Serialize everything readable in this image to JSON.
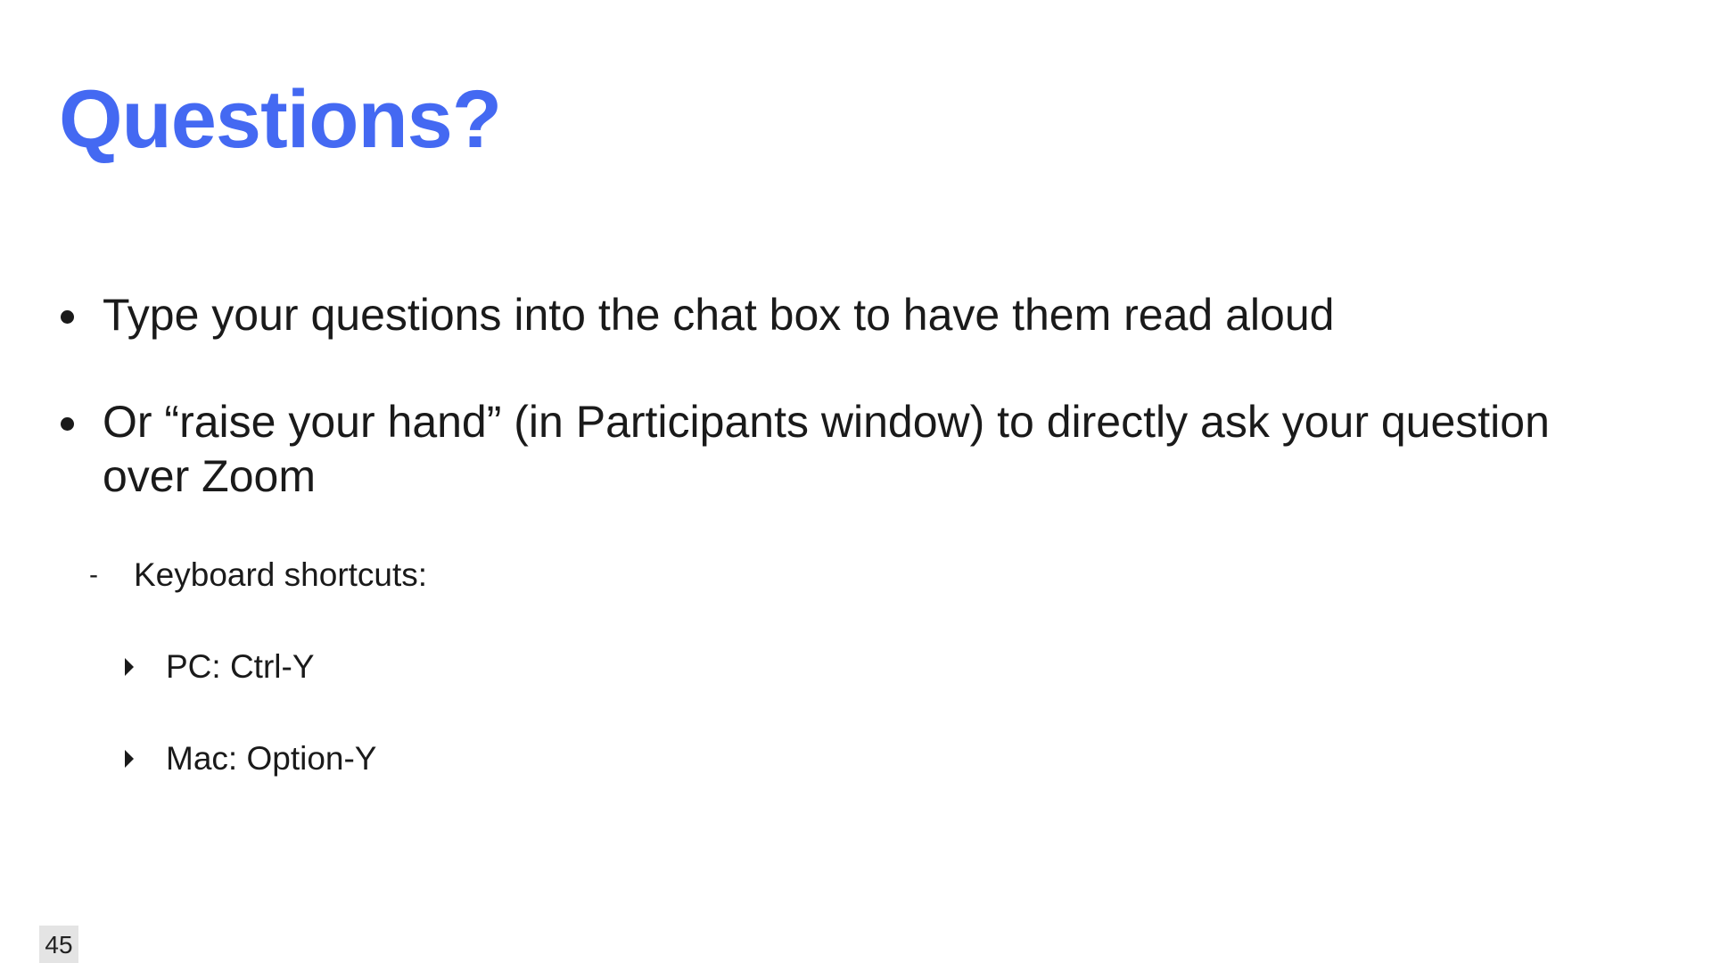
{
  "slide": {
    "title": "Questions?",
    "bullets": [
      {
        "text": "Type your questions into the chat box to have them read aloud"
      },
      {
        "text": "Or “raise your hand” (in Participants window) to directly ask your question over Zoom"
      }
    ],
    "sub_item": {
      "marker": "-",
      "text": "Keyboard shortcuts:"
    },
    "sub_sub_items": [
      {
        "text": "PC: Ctrl-Y"
      },
      {
        "text": "Mac: Option-Y"
      }
    ],
    "page_number": "45"
  },
  "colors": {
    "title": "#4469f2",
    "text": "#1a1a1a",
    "background": "#ffffff",
    "page_number_bg": "#e4e4e4"
  },
  "icons": {
    "bullet": "bullet-dot-icon",
    "sub_sub_bullet": "triangle-right-icon"
  }
}
